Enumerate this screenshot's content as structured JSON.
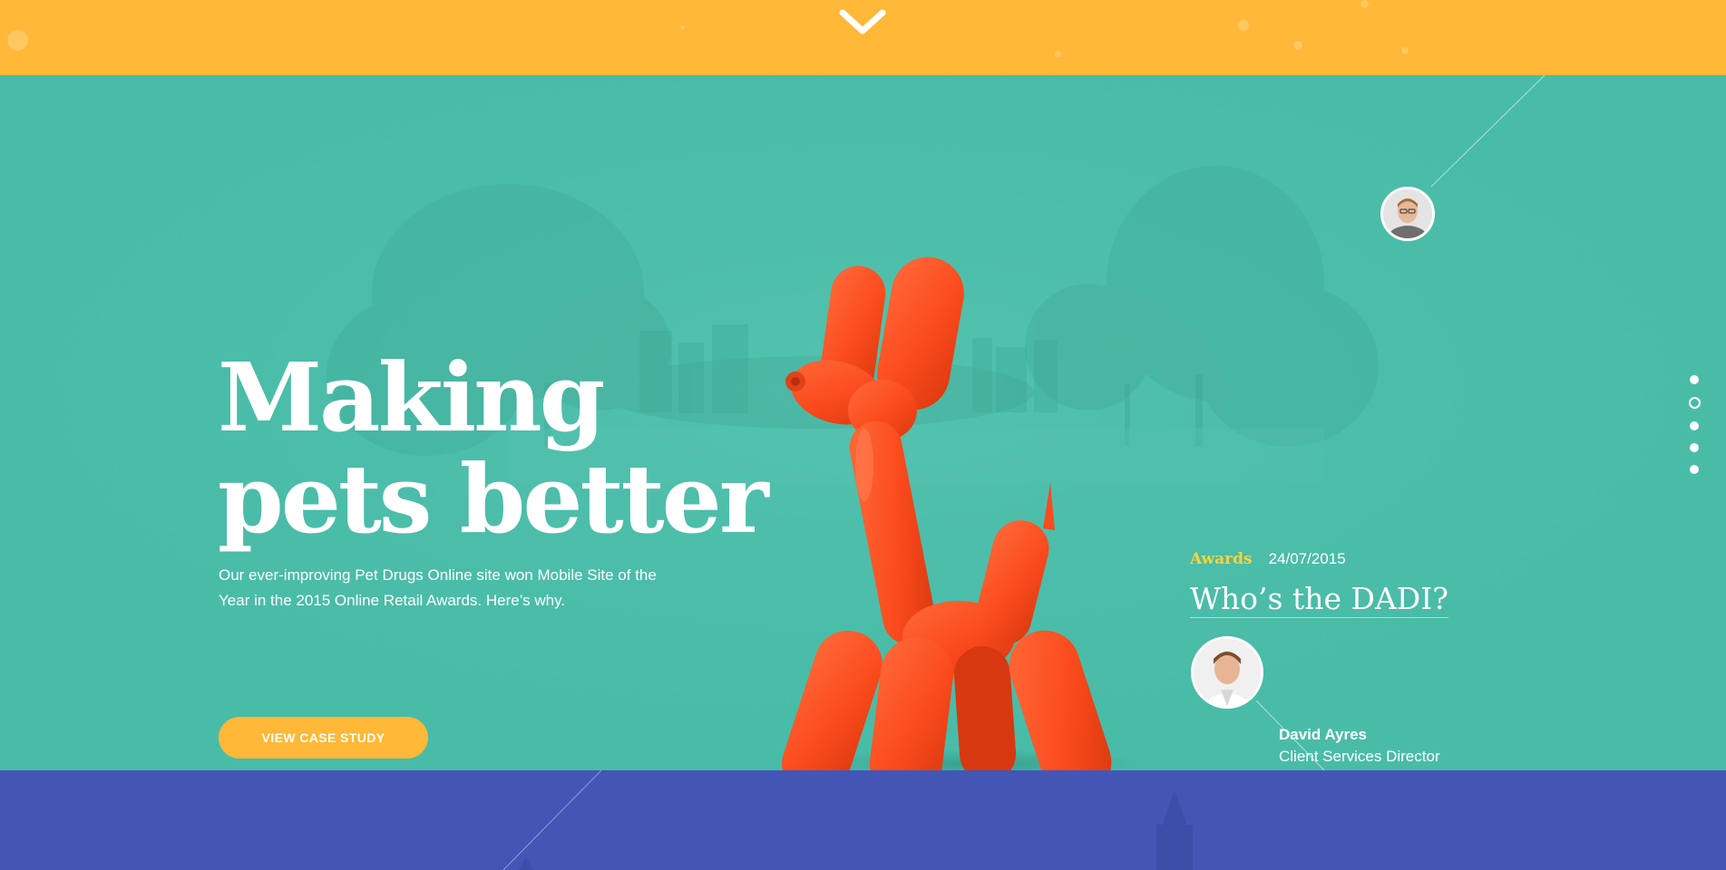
{
  "colors": {
    "yellow_band": "#ffb837",
    "hero_teal": "#49bca8",
    "balloon_orange": "#fb4b1d",
    "blue_band": "#4356b6",
    "category_accent": "#ffd23a",
    "text": "#ffffff"
  },
  "top_band": {
    "scroll_icon": "chevron-down-icon"
  },
  "hero": {
    "title_line1": "Making",
    "title_line2": "pets better",
    "description": "Our ever-improving Pet Drugs Online site won Mobile Site of the Year in the 2015 Online Retail Awards. Here’s why.",
    "cta_label": "VIEW CASE STUDY",
    "image": "orange-balloon-dog"
  },
  "news": {
    "category": "Awards",
    "date": "24/07/2015",
    "title": "Who’s the DADI?",
    "author_name": "David Ayres",
    "author_role": "Client Services Director"
  },
  "pager": {
    "count": 5,
    "active_index": 1
  }
}
